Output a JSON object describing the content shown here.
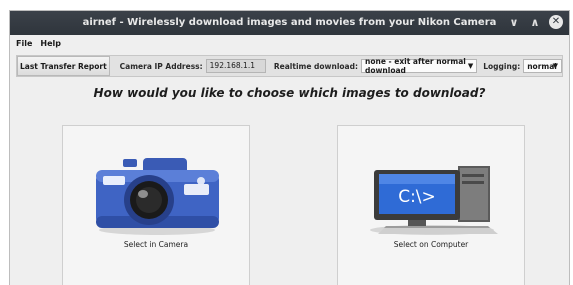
{
  "window": {
    "title": "airnef - Wirelessly download images and movies from your Nikon Camera",
    "controls": {
      "minimize_glyph": "∨",
      "maximize_glyph": "∧",
      "close_glyph": "✕"
    }
  },
  "menu": {
    "items": [
      {
        "label": "File"
      },
      {
        "label": "Help"
      }
    ]
  },
  "toolbar": {
    "report_button_label": "Last Transfer Report",
    "ip_label": "Camera IP Address:",
    "ip_value": "192.168.1.1",
    "realtime_label": "Realtime download:",
    "realtime_value": "none - exit after normal download",
    "logging_label": "Logging:",
    "logging_value": "normal"
  },
  "main": {
    "question": "How would you like to choose which images to download?",
    "options": [
      {
        "label": "Select in Camera",
        "icon": "camera-icon"
      },
      {
        "label": "Select on Computer",
        "icon": "computer-icon"
      }
    ],
    "terminal_text": "C:\\>"
  },
  "colors": {
    "titlebar": "#2f353c",
    "camera_blue": "#3f64c4",
    "window_bg": "#efefef"
  }
}
